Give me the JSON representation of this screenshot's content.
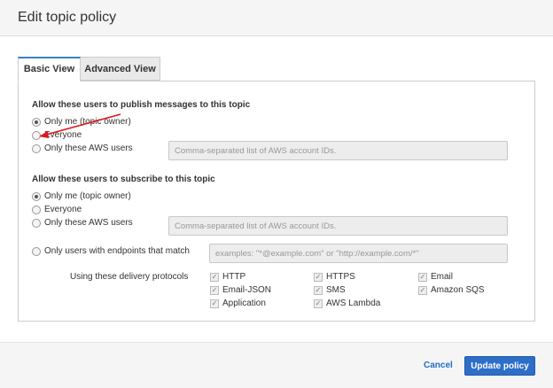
{
  "dialog": {
    "title": "Edit topic policy"
  },
  "tabs": [
    {
      "label": "Basic View",
      "active": true
    },
    {
      "label": "Advanced View",
      "active": false
    }
  ],
  "publish": {
    "title": "Allow these users to publish messages to this topic",
    "options": [
      {
        "label": "Only me (topic owner)",
        "checked": true
      },
      {
        "label": "Everyone",
        "checked": false
      },
      {
        "label": "Only these AWS users",
        "checked": false
      }
    ],
    "aws_users_placeholder": "Comma-separated list of AWS account IDs."
  },
  "subscribe": {
    "title": "Allow these users to subscribe to this topic",
    "options": [
      {
        "label": "Only me (topic owner)",
        "checked": true
      },
      {
        "label": "Everyone",
        "checked": false
      },
      {
        "label": "Only these AWS users",
        "checked": false
      },
      {
        "label": "Only users with endpoints that match",
        "checked": false
      }
    ],
    "aws_users_placeholder": "Comma-separated list of AWS account IDs.",
    "endpoints_placeholder": "examples: \"*@example.com\" or \"http://example.com/*\""
  },
  "protocols": {
    "label": "Using these delivery protocols",
    "items": [
      {
        "label": "HTTP",
        "checked": true
      },
      {
        "label": "HTTPS",
        "checked": true
      },
      {
        "label": "Email",
        "checked": true
      },
      {
        "label": "Email-JSON",
        "checked": true
      },
      {
        "label": "SMS",
        "checked": true
      },
      {
        "label": "Amazon SQS",
        "checked": true
      },
      {
        "label": "Application",
        "checked": true
      },
      {
        "label": "AWS Lambda",
        "checked": true
      }
    ]
  },
  "footer": {
    "cancel_label": "Cancel",
    "update_label": "Update policy"
  },
  "colors": {
    "primary": "#2d6ec9",
    "link": "#1e6ec2",
    "tab_accent": "#3b80c4",
    "annotation": "#e0141b"
  },
  "icons": {
    "radio": "radio-icon",
    "checkbox": "checkmark-icon",
    "annotation": "red-arrow-icon"
  }
}
